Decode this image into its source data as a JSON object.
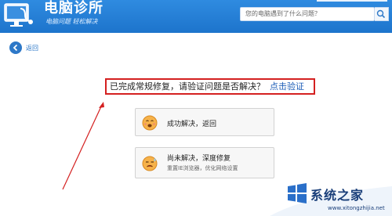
{
  "header": {
    "title": "电脑诊所",
    "slogan": "电脑问题  轻松解决",
    "search_placeholder": "您的电脑遇到了什么问题？"
  },
  "nav": {
    "back_label": "返回"
  },
  "notice": {
    "text": "已完成常规修复，请验证问题是否解决？",
    "verify_link": "点击验证"
  },
  "options": [
    {
      "title": "成功解决，返回",
      "subtitle": ""
    },
    {
      "title": "尚未解决，深度修复",
      "subtitle": "重置IE浏览器，优化网络设置"
    }
  ],
  "watermark": {
    "name": "系统之家",
    "url": "www.xitongzhijia.net"
  },
  "colors": {
    "header_blue": "#1f78d1",
    "link_blue": "#1f5fb8",
    "highlight_red": "#d42020",
    "face_orange": "#f0a23c"
  },
  "icons": {
    "logo": "monitor-stethoscope-icon",
    "back": "arrow-left-circle-icon",
    "search": "magnifier-icon",
    "option_1": "happy-face-icon",
    "option_2": "sweating-face-icon",
    "watermark": "windows-logo-icon"
  }
}
